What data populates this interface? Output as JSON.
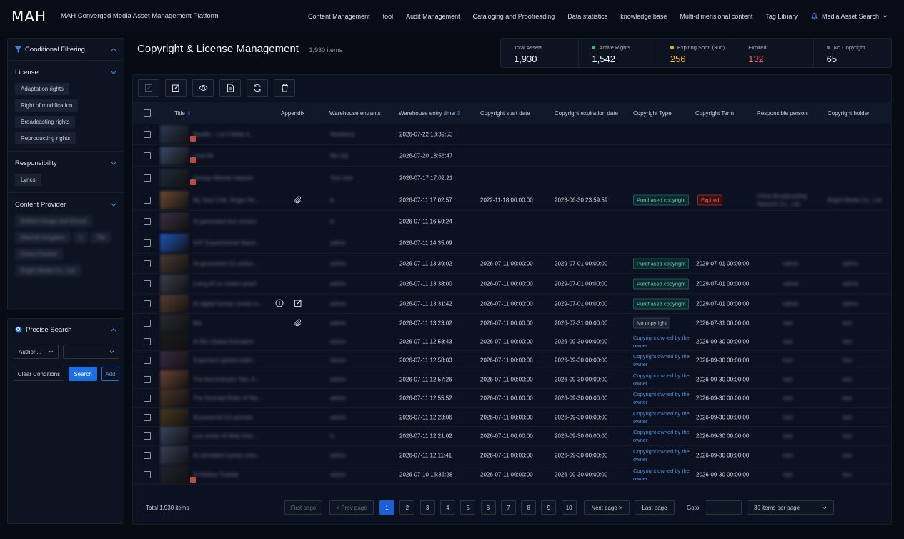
{
  "header": {
    "logo": "MAH",
    "title": "MAH Converged Media Asset Management Platform",
    "nav": [
      "Content Management",
      "tool",
      "Audit Management",
      "Cataloging and Proofreading",
      "Data statistics",
      "knowledge base",
      "Multi-dimensional content",
      "Tag Library"
    ],
    "search_label": "Media Asset Search"
  },
  "filter": {
    "title": "Conditional Filtering",
    "license": {
      "label": "License",
      "tags": [
        "Adaptation rights",
        "Right of modification",
        "Broadcasting rights",
        "Reproducting rights"
      ]
    },
    "responsibility": {
      "label": "Responsibility",
      "tags": [
        "Lyrics"
      ]
    },
    "provider": {
      "label": "Content Provider",
      "tags": [
        "Brilliant Image and Sound",
        "Warmth Kingdom",
        "1",
        "TM",
        "Green Partner",
        "Bright Media Co., Ltd."
      ]
    }
  },
  "precise": {
    "title": "Precise Search",
    "select1": "Authori...",
    "select2": "",
    "clear": "Clear Conditions",
    "search": "Search",
    "add": "Add"
  },
  "page": {
    "title": "Copyright & License Management",
    "count": "1,930 items"
  },
  "stats": [
    {
      "label": "Total Assets",
      "value": "1,930",
      "color": "#f0f3f8",
      "dot": ""
    },
    {
      "label": "Active Rights",
      "value": "1,542",
      "color": "#f0f3f8",
      "dot": "#2fbf71"
    },
    {
      "label": "Expiring Soon (30d)",
      "value": "256",
      "color": "#f0b429",
      "dot": "#f0b429"
    },
    {
      "label": "Expired",
      "value": "132",
      "color": "#ef6464",
      "dot": ""
    },
    {
      "label": "No Copyright",
      "value": "65",
      "color": "#f0f3f8",
      "dot": "#6b7280"
    }
  ],
  "table": {
    "headers": {
      "title": "Title",
      "appendix": "Appendix",
      "entrants": "Warehouse entrants",
      "entry_time": "Warehouse entry time",
      "start": "Copyright start date",
      "expiry": "Copyright expiration date",
      "type": "Copyright Type",
      "term": "Copyright Term",
      "person": "Responsible person",
      "holder": "Copyright holder"
    },
    "rows": [
      {
        "title": "Wealth – Let it Make it...",
        "entrant": "Weekend",
        "time": "2026-07-22 18:39:53",
        "start": "",
        "expiry": "",
        "type": "",
        "tstyle": "",
        "term": "",
        "person": "",
        "holder": "",
        "app": "",
        "h": 30,
        "badge": true
      },
      {
        "title": "Love All",
        "entrant": "Mo Lily",
        "time": "2026-07-20 18:56:47",
        "start": "",
        "expiry": "",
        "type": "",
        "tstyle": "",
        "term": "",
        "person": "",
        "holder": "",
        "app": "",
        "h": 30,
        "badge": true
      },
      {
        "title": "Omega Melody Happen",
        "entrant": "Test user",
        "time": "2026-07-17 17:02:21",
        "start": "",
        "expiry": "",
        "type": "",
        "tstyle": "",
        "term": "",
        "person": "",
        "holder": "",
        "app": "",
        "h": 32,
        "badge": true
      },
      {
        "title": "My Soul Chill, Singer Re...",
        "entrant": "ls",
        "time": "2026-07-11 17:02:57",
        "start": "2022-11-18 00:00:00",
        "expiry": "2023-06-30 23:59:59",
        "type": "Purchased copyright",
        "tstyle": "p",
        "term": "Expired",
        "person": "China Broadcasting Network Co., Ltd.",
        "holder": "Bright Media Co., Ltd.",
        "app": "clip",
        "h": 30,
        "badge": false
      },
      {
        "title": "AI generated test version",
        "entrant": "ls",
        "time": "2026-07-11 16:59:24",
        "start": "",
        "expiry": "",
        "type": "",
        "tstyle": "",
        "term": "",
        "person": "",
        "holder": "",
        "app": "",
        "h": 30,
        "badge": false
      },
      {
        "title": "AAT Experimental Stand...",
        "entrant": "admin",
        "time": "2026-07-11 14:35:09",
        "start": "",
        "expiry": "",
        "type": "",
        "tstyle": "",
        "term": "",
        "person": "",
        "holder": "",
        "app": "",
        "h": 30,
        "badge": false
      },
      {
        "title": "AI-generated CG action...",
        "entrant": "admin",
        "time": "2026-07-11 13:39:02",
        "start": "2026-07-11 00:00:00",
        "expiry": "2029-07-01 00:00:00",
        "type": "Purchased copyright",
        "tstyle": "p",
        "term": "2029-07-01 00:00:00",
        "person": "admin",
        "holder": "admin",
        "app": "",
        "h": 28,
        "badge": false
      },
      {
        "title": "Living AI vs creator proof",
        "entrant": "admin",
        "time": "2026-07-11 13:38:00",
        "start": "2026-07-11 00:00:00",
        "expiry": "2029-07-01 00:00:00",
        "type": "Purchased copyright",
        "tstyle": "p",
        "term": "2029-07-01 00:00:00",
        "person": "admin",
        "holder": "admin",
        "app": "",
        "h": 28,
        "badge": false
      },
      {
        "title": "AI digital human reveal co...",
        "entrant": "admin",
        "time": "2026-07-11 13:31:42",
        "start": "2026-07-11 00:00:00",
        "expiry": "2029-07-01 00:00:00",
        "type": "Purchased copyright",
        "tstyle": "p",
        "term": "2029-07-01 00:00:00",
        "person": "admin",
        "holder": "admin",
        "app": "info-edit",
        "h": 28,
        "badge": false
      },
      {
        "title": "Mix",
        "entrant": "admin",
        "time": "2026-07-11 13:23:02",
        "start": "2026-07-11 00:00:00",
        "expiry": "2026-07-31 00:00:00",
        "type": "No copyright",
        "tstyle": "n",
        "term": "2026-07-31 00:00:00",
        "person": "test",
        "holder": "test",
        "app": "clip",
        "h": 26,
        "badge": false
      },
      {
        "title": "AI film Global Animation",
        "entrant": "admin",
        "time": "2026-07-11 12:58:43",
        "start": "2026-07-11 00:00:00",
        "expiry": "2026-09-30 00:00:00",
        "type": "Copyright owned by the owner",
        "tstyle": "o",
        "term": "2026-09-30 00:00:00",
        "person": "test",
        "holder": "test",
        "app": "",
        "h": 26,
        "badge": false
      },
      {
        "title": "Superhero global trailer...",
        "entrant": "admin",
        "time": "2026-07-11 12:58:03",
        "start": "2026-07-11 00:00:00",
        "expiry": "2026-09-30 00:00:00",
        "type": "Copyright owned by the owner",
        "tstyle": "o",
        "term": "2026-09-30 00:00:00",
        "person": "test",
        "holder": "test",
        "app": "",
        "h": 27,
        "badge": false
      },
      {
        "title": "The first Animal's Tale, A...",
        "entrant": "admin",
        "time": "2026-07-11 12:57:26",
        "start": "2026-07-11 00:00:00",
        "expiry": "2026-09-30 00:00:00",
        "type": "Copyright owned by the owner",
        "tstyle": "o",
        "term": "2026-09-30 00:00:00",
        "person": "test",
        "holder": "test",
        "app": "",
        "h": 26,
        "badge": false
      },
      {
        "title": "The Scorned Ruler of Sta...",
        "entrant": "admin",
        "time": "2026-07-11 12:55:52",
        "start": "2026-07-11 00:00:00",
        "expiry": "2026-09-30 00:00:00",
        "type": "Copyright owned by the owner",
        "tstyle": "o",
        "term": "2026-09-30 00:00:00",
        "person": "test",
        "holder": "test",
        "app": "",
        "h": 27,
        "badge": false
      },
      {
        "title": "AI-powered CG pioneer",
        "entrant": "admin",
        "time": "2026-07-11 12:23:06",
        "start": "2026-07-11 00:00:00",
        "expiry": "2026-09-30 00:00:00",
        "type": "Copyright owned by the owner",
        "tstyle": "o",
        "term": "2026-09-30 00:00:00",
        "person": "test",
        "holder": "test",
        "app": "",
        "h": 26,
        "badge": false
      },
      {
        "title": "Live action AI Web Inter...",
        "entrant": "ls",
        "time": "2026-07-11 12:21:02",
        "start": "2026-07-11 00:00:00",
        "expiry": "2026-09-30 00:00:00",
        "type": "Copyright owned by the owner",
        "tstyle": "o",
        "term": "2026-09-30 00:00:00",
        "person": "test",
        "holder": "test",
        "app": "",
        "h": 27,
        "badge": false
      },
      {
        "title": "AI simulated human exte...",
        "entrant": "admin",
        "time": "2026-07-11 12:11:41",
        "start": "2026-07-11 00:00:00",
        "expiry": "2026-09-30 00:00:00",
        "type": "Copyright owned by the owner",
        "tstyle": "o",
        "term": "2026-09-30 00:00:00",
        "person": "test",
        "holder": "test",
        "app": "",
        "h": 27,
        "badge": false
      },
      {
        "title": "AI Mellow Tradate",
        "entrant": "admin",
        "time": "2026-07-10 16:36:28",
        "start": "2026-07-11 00:00:00",
        "expiry": "2026-09-30 00:00:00",
        "type": "Copyright owned by the owner",
        "tstyle": "o",
        "term": "2026-09-30 00:00:00",
        "person": "test",
        "holder": "test",
        "app": "",
        "h": 27,
        "badge": true
      }
    ]
  },
  "pagination": {
    "total": "Total 1,930 items",
    "first": "First page",
    "prev": "< Prev page",
    "pages": [
      "1",
      "2",
      "3",
      "4",
      "5",
      "6",
      "7",
      "8",
      "9",
      "10"
    ],
    "next": "Next page >",
    "last": "Last page",
    "goto": "Goto",
    "per_page": "30 items per page"
  }
}
